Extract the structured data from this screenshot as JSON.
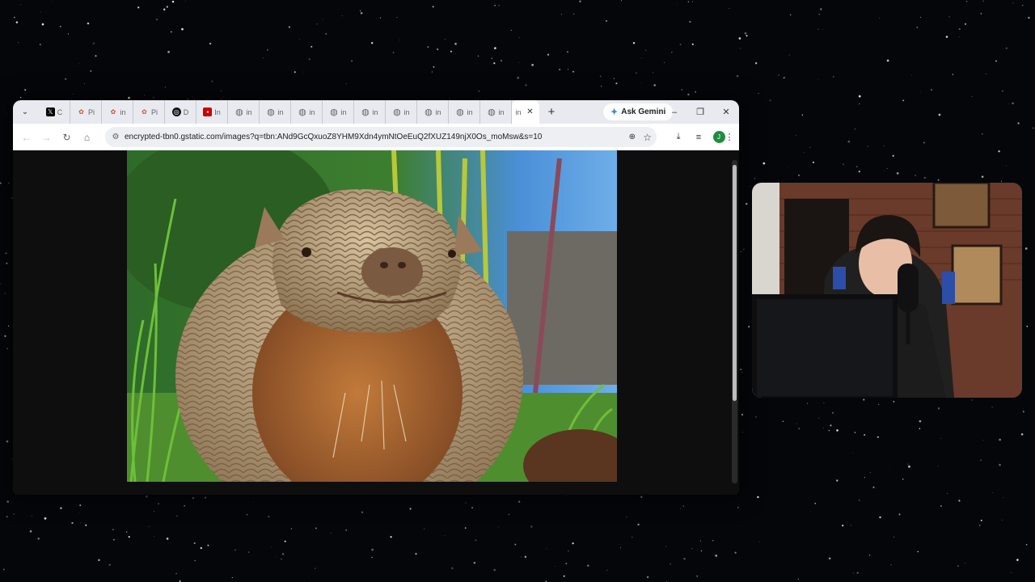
{
  "browser": {
    "tab_search_icon": "chevron-down-icon",
    "tabs": [
      {
        "label": "C",
        "icon": "x-logo-icon",
        "color": "#000000"
      },
      {
        "label": "Pi",
        "icon": "plant-icon",
        "color": "#e8eaf0"
      },
      {
        "label": "in",
        "icon": "plant-icon",
        "color": "#e8eaf0"
      },
      {
        "label": "Pi",
        "icon": "plant-icon",
        "color": "#e8eaf0"
      },
      {
        "label": "D",
        "icon": "chatgpt-icon",
        "color": "#111111"
      },
      {
        "label": "In",
        "icon": "news-icon",
        "color": "#cc0000"
      },
      {
        "label": "in",
        "icon": "globe-icon",
        "color": "#5f6368"
      },
      {
        "label": "in",
        "icon": "globe-icon",
        "color": "#5f6368"
      },
      {
        "label": "in",
        "icon": "globe-icon",
        "color": "#5f6368"
      },
      {
        "label": "in",
        "icon": "globe-icon",
        "color": "#5f6368"
      },
      {
        "label": "in",
        "icon": "globe-icon",
        "color": "#5f6368"
      },
      {
        "label": "in",
        "icon": "globe-icon",
        "color": "#5f6368"
      },
      {
        "label": "in",
        "icon": "globe-icon",
        "color": "#5f6368"
      },
      {
        "label": "in",
        "icon": "globe-icon",
        "color": "#5f6368"
      },
      {
        "label": "in",
        "icon": "globe-icon",
        "color": "#5f6368"
      }
    ],
    "active_tab": {
      "label": "in"
    },
    "new_tab": "+",
    "ask_gemini": "Ask Gemini",
    "window_controls": [
      "–",
      "❐",
      "✕"
    ],
    "url": "encrypted-tbn0.gstatic.com/images?q=tbn:ANd9GcQxuoZ8YHM9Xdn4ymNtOeEuQ2fXUZ149njX0Os_moMsw&s=10",
    "profile_initial": "J",
    "accent": "#1a73e8"
  },
  "content": {
    "image_subject": "armadillo-photo"
  }
}
